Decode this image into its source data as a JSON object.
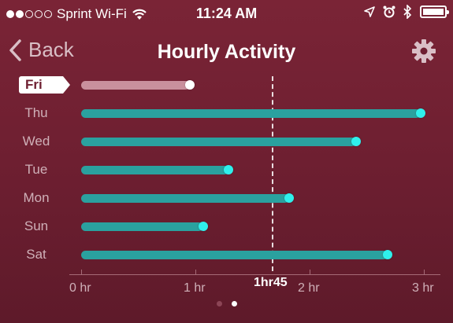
{
  "status_bar": {
    "carrier": "Sprint Wi-Fi",
    "signal_bars": 2,
    "signal_max": 5,
    "time": "11:24 AM",
    "icons": [
      "wifi-icon",
      "location-arrow-icon",
      "alarm-icon",
      "bluetooth-icon",
      "battery-icon"
    ]
  },
  "nav": {
    "back_label": "Back",
    "title": "Hourly Activity",
    "settings_icon": "gear-icon"
  },
  "chart_data": {
    "type": "bar",
    "orientation": "horizontal",
    "categories": [
      "Fri",
      "Thu",
      "Wed",
      "Tue",
      "Mon",
      "Sun",
      "Sat"
    ],
    "values_hr": [
      0.95,
      2.97,
      2.41,
      1.29,
      1.82,
      1.07,
      2.68
    ],
    "selected": "Fri",
    "x_ticks": [
      "0 hr",
      "1 hr",
      "2 hr",
      "3 hr"
    ],
    "xlim": [
      0,
      3
    ],
    "goal": {
      "value_hr": 1.75,
      "label": "1hr45"
    },
    "colors": {
      "bar": "#2aa19f",
      "knob": "#2ff0ec",
      "selected_bar": "#c9909d",
      "selected_knob": "#ffffff"
    }
  },
  "pager": {
    "count": 2,
    "active": 1
  },
  "colors": {
    "background": "#6e1f31",
    "label": "#cfb0b8"
  }
}
